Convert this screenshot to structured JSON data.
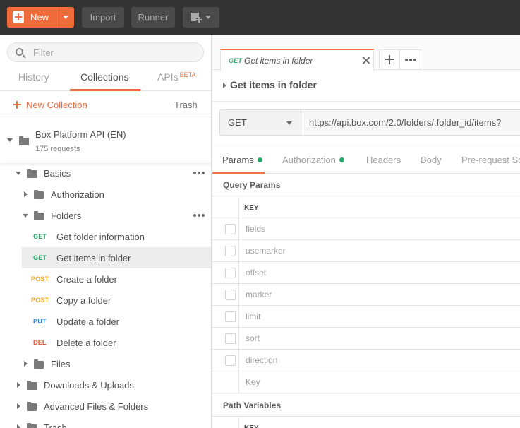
{
  "toolbar": {
    "new_label": "New",
    "import_label": "Import",
    "runner_label": "Runner"
  },
  "sidebar": {
    "filter_placeholder": "Filter",
    "tabs": {
      "history": "History",
      "collections": "Collections",
      "apis": "APIs",
      "apis_badge": "BETA"
    },
    "new_collection": "New Collection",
    "trash": "Trash",
    "collection": {
      "name": "Box Platform API (EN)",
      "count": "175 requests"
    },
    "tree": [
      {
        "label": "Basics"
      },
      {
        "label": "Authorization"
      },
      {
        "label": "Folders"
      },
      {
        "method": "GET",
        "label": "Get folder information"
      },
      {
        "method": "GET",
        "label": "Get items in folder"
      },
      {
        "method": "POST",
        "label": "Create a folder"
      },
      {
        "method": "POST",
        "label": "Copy a folder"
      },
      {
        "method": "PUT",
        "label": "Update a folder"
      },
      {
        "method": "DEL",
        "label": "Delete a folder"
      },
      {
        "label": "Files"
      },
      {
        "label": "Downloads & Uploads"
      },
      {
        "label": "Advanced Files & Folders"
      },
      {
        "label": "Trash"
      }
    ]
  },
  "main": {
    "open_tab": {
      "method": "GET",
      "name": "Get items in folder"
    },
    "request_title": "Get items in folder",
    "method": "GET",
    "url": "https://api.box.com/2.0/folders/:folder_id/items?",
    "request_tabs": [
      "Params",
      "Authorization",
      "Headers",
      "Body",
      "Pre-request Script"
    ],
    "query_params_title": "Query Params",
    "key_header": "KEY",
    "params": [
      "fields",
      "usemarker",
      "offset",
      "marker",
      "limit",
      "sort",
      "direction"
    ],
    "key_placeholder": "Key",
    "path_variables_title": "Path Variables"
  },
  "colors": {
    "accent": "#f26b3a",
    "get": "#26a96c",
    "post": "#f5a623",
    "put": "#2f80d1",
    "delete": "#e0533a"
  }
}
